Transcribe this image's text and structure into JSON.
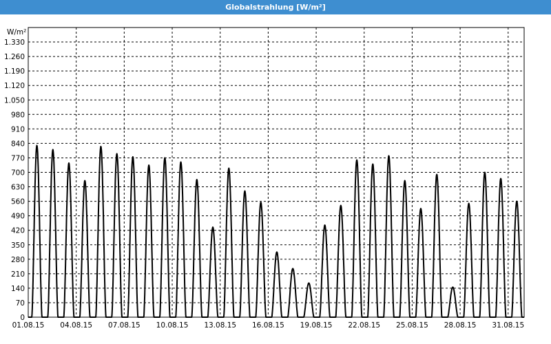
{
  "window": {
    "title": "Globalstrahlung [W/m²]"
  },
  "chart_data": {
    "type": "line",
    "title": "Globalstrahlung [W/m²]",
    "ylabel": "W/m²",
    "xlabel": "",
    "ylim": [
      0,
      1400
    ],
    "yticks": [
      0,
      70,
      140,
      210,
      280,
      350,
      420,
      490,
      560,
      630,
      700,
      770,
      840,
      910,
      980,
      1050,
      1120,
      1190,
      1260,
      1330
    ],
    "ytick_labels": [
      "0",
      "70",
      "140",
      "210",
      "280",
      "350",
      "420",
      "490",
      "560",
      "630",
      "700",
      "770",
      "840",
      "910",
      "980",
      "1.050",
      "1.120",
      "1.190",
      "1.260",
      "1.330"
    ],
    "xlim": [
      "01.08.15",
      "01.09.15"
    ],
    "xtick_labels": [
      "01.08.15",
      "04.08.15",
      "07.08.15",
      "10.08.15",
      "13.08.15",
      "16.08.15",
      "19.08.15",
      "22.08.15",
      "25.08.15",
      "28.08.15",
      "31.08.15"
    ],
    "grid": true,
    "line_color": "#000000",
    "series": [
      {
        "daily_peaks": [
          {
            "date": "01.08.15",
            "max": 830
          },
          {
            "date": "02.08.15",
            "max": 810
          },
          {
            "date": "03.08.15",
            "max": 745
          },
          {
            "date": "04.08.15",
            "max": 660
          },
          {
            "date": "05.08.15",
            "max": 825
          },
          {
            "date": "06.08.15",
            "max": 790
          },
          {
            "date": "07.08.15",
            "max": 775
          },
          {
            "date": "08.08.15",
            "max": 735
          },
          {
            "date": "09.08.15",
            "max": 770
          },
          {
            "date": "10.08.15",
            "max": 750
          },
          {
            "date": "11.08.15",
            "max": 665
          },
          {
            "date": "12.08.15",
            "max": 435
          },
          {
            "date": "13.08.15",
            "max": 720
          },
          {
            "date": "14.08.15",
            "max": 610
          },
          {
            "date": "15.08.15",
            "max": 555
          },
          {
            "date": "16.08.15",
            "max": 315
          },
          {
            "date": "17.08.15",
            "max": 235
          },
          {
            "date": "18.08.15",
            "max": 165
          },
          {
            "date": "19.08.15",
            "max": 445
          },
          {
            "date": "20.08.15",
            "max": 540
          },
          {
            "date": "21.08.15",
            "max": 760
          },
          {
            "date": "22.08.15",
            "max": 740
          },
          {
            "date": "23.08.15",
            "max": 780
          },
          {
            "date": "24.08.15",
            "max": 660
          },
          {
            "date": "25.08.15",
            "max": 525
          },
          {
            "date": "26.08.15",
            "max": 690
          },
          {
            "date": "27.08.15",
            "max": 145
          },
          {
            "date": "28.08.15",
            "max": 550
          },
          {
            "date": "29.08.15",
            "max": 700
          },
          {
            "date": "30.08.15",
            "max": 670
          },
          {
            "date": "31.08.15",
            "max": 560
          }
        ]
      }
    ]
  }
}
